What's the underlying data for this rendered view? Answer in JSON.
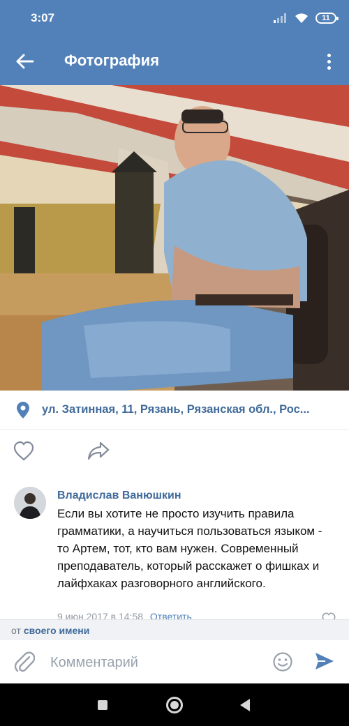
{
  "status_bar": {
    "time": "3:07",
    "battery": "11",
    "icons": [
      "signal-icon",
      "wifi-icon",
      "battery-icon"
    ]
  },
  "app_bar": {
    "title": "Фотография",
    "icons": [
      "back-arrow-icon",
      "more-vertical-icon"
    ],
    "color": "#5181b8"
  },
  "photo": {
    "description_icon": "photo-image"
  },
  "location": {
    "icon": "location-pin-icon",
    "text": "ул. Затинная, 11, Рязань, Рязанская обл., Рос..."
  },
  "actions": {
    "icons": [
      "heart-icon",
      "share-icon"
    ]
  },
  "comment": {
    "author": "Владислав Ванюшкин",
    "text": "Если вы хотите не просто изучить правила грамматики, а научиться пользоваться языком - то Артем, тот, кто вам нужен. Современный преподаватель, который расскажет о фишках и лайфхаках разговорного английского.",
    "date": "9 июн 2017 в 14:58",
    "reply_label": "Ответить"
  },
  "from_bar": {
    "prefix": "от",
    "link": "своего имени"
  },
  "input_bar": {
    "placeholder": "Комментарий",
    "icons": [
      "attach-icon",
      "emoji-icon",
      "send-icon"
    ]
  },
  "colors": {
    "accent": "#5181b8",
    "link": "#3f6a9a",
    "muted": "#939aa3"
  }
}
